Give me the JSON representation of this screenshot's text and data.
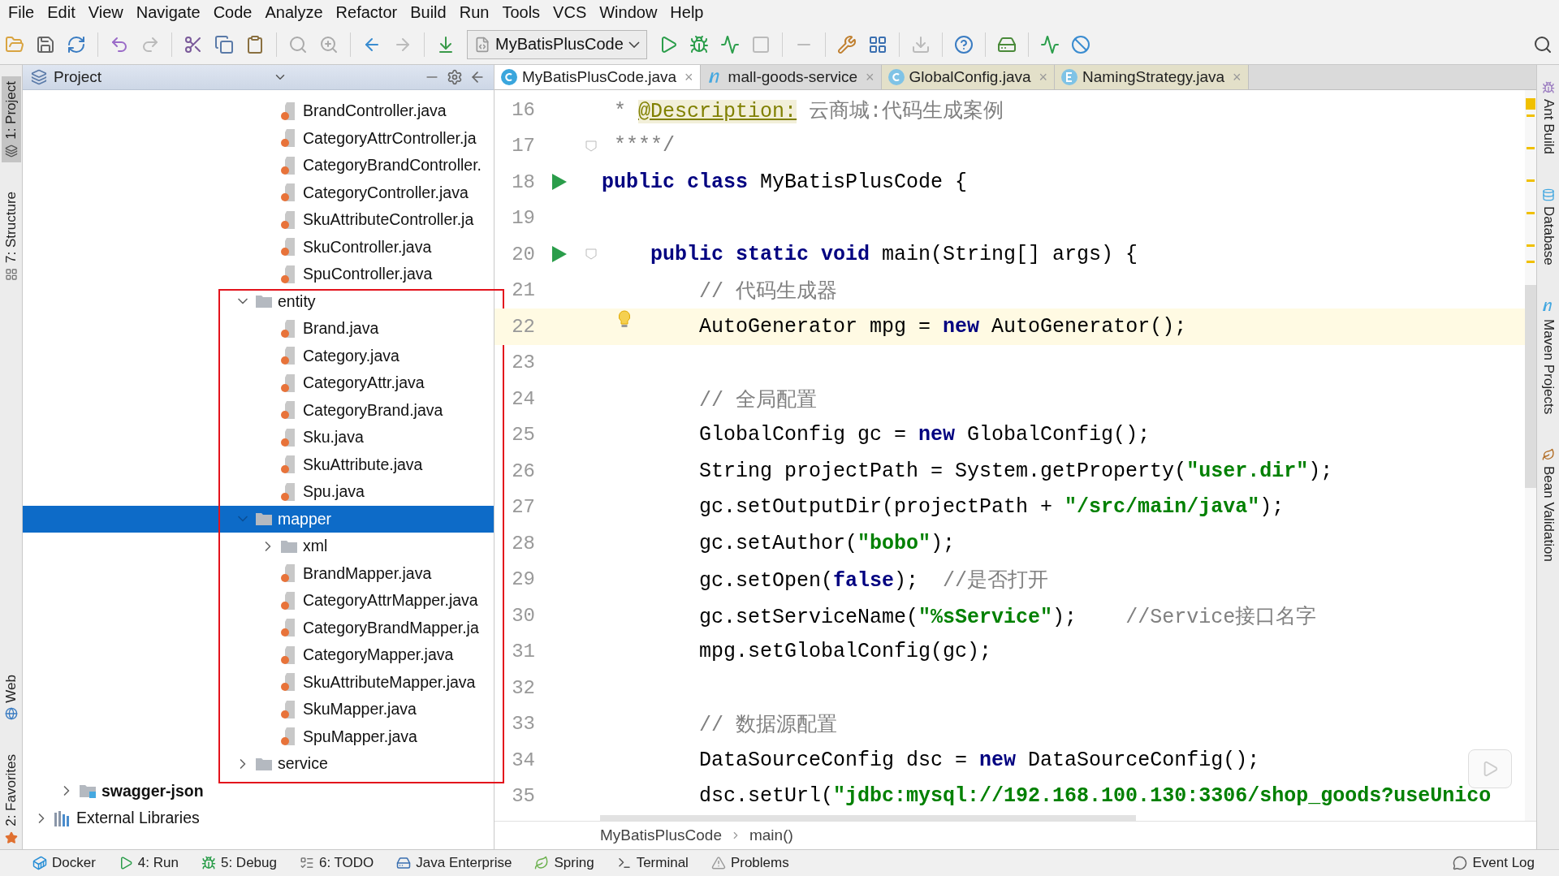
{
  "menu": [
    "File",
    "Edit",
    "View",
    "Navigate",
    "Code",
    "Analyze",
    "Refactor",
    "Build",
    "Run",
    "Tools",
    "VCS",
    "Window",
    "Help"
  ],
  "toolbar": {
    "run_config": "MyBatisPlusCode"
  },
  "left_stripe": [
    {
      "label": "1: Project",
      "kind": "project",
      "selected": true
    },
    {
      "label": "7: Structure",
      "kind": "structure",
      "selected": false
    },
    {
      "label": "Web",
      "kind": "web",
      "selected": false
    },
    {
      "label": "2: Favorites",
      "kind": "favorites",
      "selected": false
    }
  ],
  "project_panel": {
    "title": "Project",
    "highlight_frame": true,
    "tree": [
      {
        "kind": "offscreen",
        "children": [
          {
            "kind": "offscreen",
            "children": [
              {
                "kind": "offscreen",
                "children": [
                  {
                    "kind": "offscreen",
                    "children": [
                      {
                        "kind": "offscreen",
                        "children": [
                          {
                            "kind": "offscreen",
                            "children": [
                              {
                                "kind": "offscreen",
                                "children": [
                                  {
                                    "kind": "offscreen",
                                    "children": [
                                      {
                                        "kind": "offscreen",
                                        "children": [
                                          {
                                            "label": "BrandController.java",
                                            "kind": "file",
                                            "selected": false
                                          },
                                          {
                                            "label": "CategoryAttrController.ja",
                                            "kind": "file",
                                            "selected": false
                                          },
                                          {
                                            "label": "CategoryBrandController.",
                                            "kind": "file",
                                            "selected": false
                                          },
                                          {
                                            "label": "CategoryController.java",
                                            "kind": "file",
                                            "selected": false
                                          },
                                          {
                                            "label": "SkuAttributeController.ja",
                                            "kind": "file",
                                            "selected": false
                                          },
                                          {
                                            "label": "SkuController.java",
                                            "kind": "file",
                                            "selected": false
                                          },
                                          {
                                            "label": "SpuController.java",
                                            "kind": "file",
                                            "selected": false
                                          }
                                        ]
                                      },
                                      {
                                        "label": "entity",
                                        "kind": "folder",
                                        "expanded": true,
                                        "selected": false,
                                        "children": [
                                          {
                                            "label": "Brand.java",
                                            "kind": "file",
                                            "selected": false
                                          },
                                          {
                                            "label": "Category.java",
                                            "kind": "file",
                                            "selected": false
                                          },
                                          {
                                            "label": "CategoryAttr.java",
                                            "kind": "file",
                                            "selected": false
                                          },
                                          {
                                            "label": "CategoryBrand.java",
                                            "kind": "file",
                                            "selected": false
                                          },
                                          {
                                            "label": "Sku.java",
                                            "kind": "file",
                                            "selected": false
                                          },
                                          {
                                            "label": "SkuAttribute.java",
                                            "kind": "file",
                                            "selected": false
                                          },
                                          {
                                            "label": "Spu.java",
                                            "kind": "file",
                                            "selected": false
                                          }
                                        ]
                                      },
                                      {
                                        "label": "mapper",
                                        "kind": "folder",
                                        "expanded": true,
                                        "selected": true,
                                        "children": [
                                          {
                                            "label": "xml",
                                            "kind": "folder",
                                            "expanded": false,
                                            "selected": false
                                          },
                                          {
                                            "label": "BrandMapper.java",
                                            "kind": "file",
                                            "selected": false
                                          },
                                          {
                                            "label": "CategoryAttrMapper.java",
                                            "kind": "file",
                                            "selected": false
                                          },
                                          {
                                            "label": "CategoryBrandMapper.ja",
                                            "kind": "file",
                                            "selected": false
                                          },
                                          {
                                            "label": "CategoryMapper.java",
                                            "kind": "file",
                                            "selected": false
                                          },
                                          {
                                            "label": "SkuAttributeMapper.java",
                                            "kind": "file",
                                            "selected": false
                                          },
                                          {
                                            "label": "SkuMapper.java",
                                            "kind": "file",
                                            "selected": false
                                          },
                                          {
                                            "label": "SpuMapper.java",
                                            "kind": "file",
                                            "selected": false
                                          }
                                        ]
                                      },
                                      {
                                        "label": "service",
                                        "kind": "folder",
                                        "expanded": false,
                                        "selected": false
                                      }
                                    ]
                                  }
                                ]
                              }
                            ]
                          }
                        ]
                      }
                    ]
                  }
                ]
              }
            ]
          },
          {
            "label": "swagger-json",
            "kind": "module",
            "expanded": false,
            "selected": false
          }
        ]
      },
      {
        "label": "External Libraries",
        "kind": "libraries",
        "expanded": false,
        "selected": false
      }
    ]
  },
  "tabs": [
    {
      "label": "MyBatisPlusCode.java",
      "kind": "class",
      "selected": true,
      "close": "×"
    },
    {
      "label": "mall-goods-service",
      "kind": "maven",
      "selected": false,
      "close": "×"
    },
    {
      "label": "GlobalConfig.java",
      "kind": "library-class",
      "selected": false,
      "close": "×"
    },
    {
      "label": "NamingStrategy.java",
      "kind": "library-enum",
      "selected": false,
      "close": "×"
    }
  ],
  "editor": {
    "lines": [
      {
        "number": "16",
        "current": false,
        "run": false,
        "fold": false,
        "bulb": false,
        "tokens": [
          {
            "kind": "comment",
            "text": " * "
          },
          {
            "kind": "annotation",
            "text": "@Description:"
          },
          {
            "kind": "comment",
            "text": " 云商城:代码生成案例"
          }
        ]
      },
      {
        "number": "17",
        "current": false,
        "run": false,
        "fold": true,
        "bulb": false,
        "tokens": [
          {
            "kind": "comment",
            "text": " ****/"
          }
        ]
      },
      {
        "number": "18",
        "current": false,
        "run": true,
        "fold": false,
        "bulb": false,
        "tokens": [
          {
            "kind": "keyword",
            "text": "public class "
          },
          {
            "kind": "plain",
            "text": "MyBatisPlusCode {"
          }
        ]
      },
      {
        "number": "19",
        "current": false,
        "run": false,
        "fold": false,
        "bulb": false
      },
      {
        "number": "20",
        "current": false,
        "run": true,
        "fold": true,
        "bulb": false,
        "tokens": [
          {
            "kind": "keyword",
            "text": "    public static void "
          },
          {
            "kind": "plain",
            "text": "main(String[] args) {"
          }
        ]
      },
      {
        "number": "21",
        "current": false,
        "run": false,
        "fold": false,
        "bulb": false,
        "tokens": [
          {
            "kind": "comment",
            "text": "        // 代码生成器"
          }
        ]
      },
      {
        "number": "22",
        "current": true,
        "run": false,
        "fold": false,
        "bulb": true,
        "tokens": [
          {
            "kind": "plain",
            "text": "        AutoGenerator mpg = "
          },
          {
            "kind": "keyword",
            "text": "new "
          },
          {
            "kind": "plain",
            "text": "AutoGenerator();"
          }
        ]
      },
      {
        "number": "23",
        "current": false,
        "run": false,
        "fold": false,
        "bulb": false
      },
      {
        "number": "24",
        "current": false,
        "run": false,
        "fold": false,
        "bulb": false,
        "tokens": [
          {
            "kind": "comment",
            "text": "        // 全局配置"
          }
        ]
      },
      {
        "number": "25",
        "current": false,
        "run": false,
        "fold": false,
        "bulb": false,
        "tokens": [
          {
            "kind": "plain",
            "text": "        GlobalConfig gc = "
          },
          {
            "kind": "keyword",
            "text": "new "
          },
          {
            "kind": "plain",
            "text": "GlobalConfig();"
          }
        ]
      },
      {
        "number": "26",
        "current": false,
        "run": false,
        "fold": false,
        "bulb": false,
        "tokens": [
          {
            "kind": "plain",
            "text": "        String projectPath = System.getProperty("
          },
          {
            "kind": "string",
            "text": "\"user.dir\""
          },
          {
            "kind": "plain",
            "text": ");"
          }
        ]
      },
      {
        "number": "27",
        "current": false,
        "run": false,
        "fold": false,
        "bulb": false,
        "tokens": [
          {
            "kind": "plain",
            "text": "        gc.setOutputDir(projectPath + "
          },
          {
            "kind": "string",
            "text": "\"/src/main/java\""
          },
          {
            "kind": "plain",
            "text": ");"
          }
        ]
      },
      {
        "number": "28",
        "current": false,
        "run": false,
        "fold": false,
        "bulb": false,
        "tokens": [
          {
            "kind": "plain",
            "text": "        gc.setAuthor("
          },
          {
            "kind": "string",
            "text": "\"bobo\""
          },
          {
            "kind": "plain",
            "text": ");"
          }
        ]
      },
      {
        "number": "29",
        "current": false,
        "run": false,
        "fold": false,
        "bulb": false,
        "tokens": [
          {
            "kind": "plain",
            "text": "        gc.setOpen("
          },
          {
            "kind": "keyword",
            "text": "false"
          },
          {
            "kind": "plain",
            "text": ");  "
          },
          {
            "kind": "comment",
            "text": "//是否打开"
          }
        ]
      },
      {
        "number": "30",
        "current": false,
        "run": false,
        "fold": false,
        "bulb": false,
        "tokens": [
          {
            "kind": "plain",
            "text": "        gc.setServiceName("
          },
          {
            "kind": "string",
            "text": "\"%sService\""
          },
          {
            "kind": "plain",
            "text": ");    "
          },
          {
            "kind": "comment",
            "text": "//Service接口名字"
          }
        ]
      },
      {
        "number": "31",
        "current": false,
        "run": false,
        "fold": false,
        "bulb": false,
        "tokens": [
          {
            "kind": "plain",
            "text": "        mpg.setGlobalConfig(gc);"
          }
        ]
      },
      {
        "number": "32",
        "current": false,
        "run": false,
        "fold": false,
        "bulb": false
      },
      {
        "number": "33",
        "current": false,
        "run": false,
        "fold": false,
        "bulb": false,
        "tokens": [
          {
            "kind": "comment",
            "text": "        // 数据源配置"
          }
        ]
      },
      {
        "number": "34",
        "current": false,
        "run": false,
        "fold": false,
        "bulb": false,
        "tokens": [
          {
            "kind": "plain",
            "text": "        DataSourceConfig dsc = "
          },
          {
            "kind": "keyword",
            "text": "new "
          },
          {
            "kind": "plain",
            "text": "DataSourceConfig();"
          }
        ]
      },
      {
        "number": "35",
        "current": false,
        "run": false,
        "fold": false,
        "bulb": false,
        "tokens": [
          {
            "kind": "plain",
            "text": "        dsc.setUrl("
          },
          {
            "kind": "string",
            "text": "\"jdbc:mysql://192.168.100.130:3306/shop_goods?useUnico"
          }
        ]
      }
    ]
  },
  "breadcrumbs": [
    "MyBatisPlusCode",
    "main()"
  ],
  "right_stripe": [
    {
      "label": "Ant Build",
      "kind": "ant"
    },
    {
      "label": "Database",
      "kind": "database"
    },
    {
      "label": "Maven Projects",
      "kind": "maven"
    },
    {
      "label": "Bean Validation",
      "kind": "bean"
    }
  ],
  "bottom_tools": [
    {
      "label": "Docker",
      "kind": "docker"
    },
    {
      "label": "4: Run",
      "kind": "run"
    },
    {
      "label": "5: Debug",
      "kind": "debug"
    },
    {
      "label": "6: TODO",
      "kind": "todo"
    },
    {
      "label": "Java Enterprise",
      "kind": "enterprise"
    },
    {
      "label": "Spring",
      "kind": "spring"
    },
    {
      "label": "Terminal",
      "kind": "terminal"
    },
    {
      "label": "Problems",
      "kind": "problems"
    }
  ],
  "event_log": "Event Log"
}
